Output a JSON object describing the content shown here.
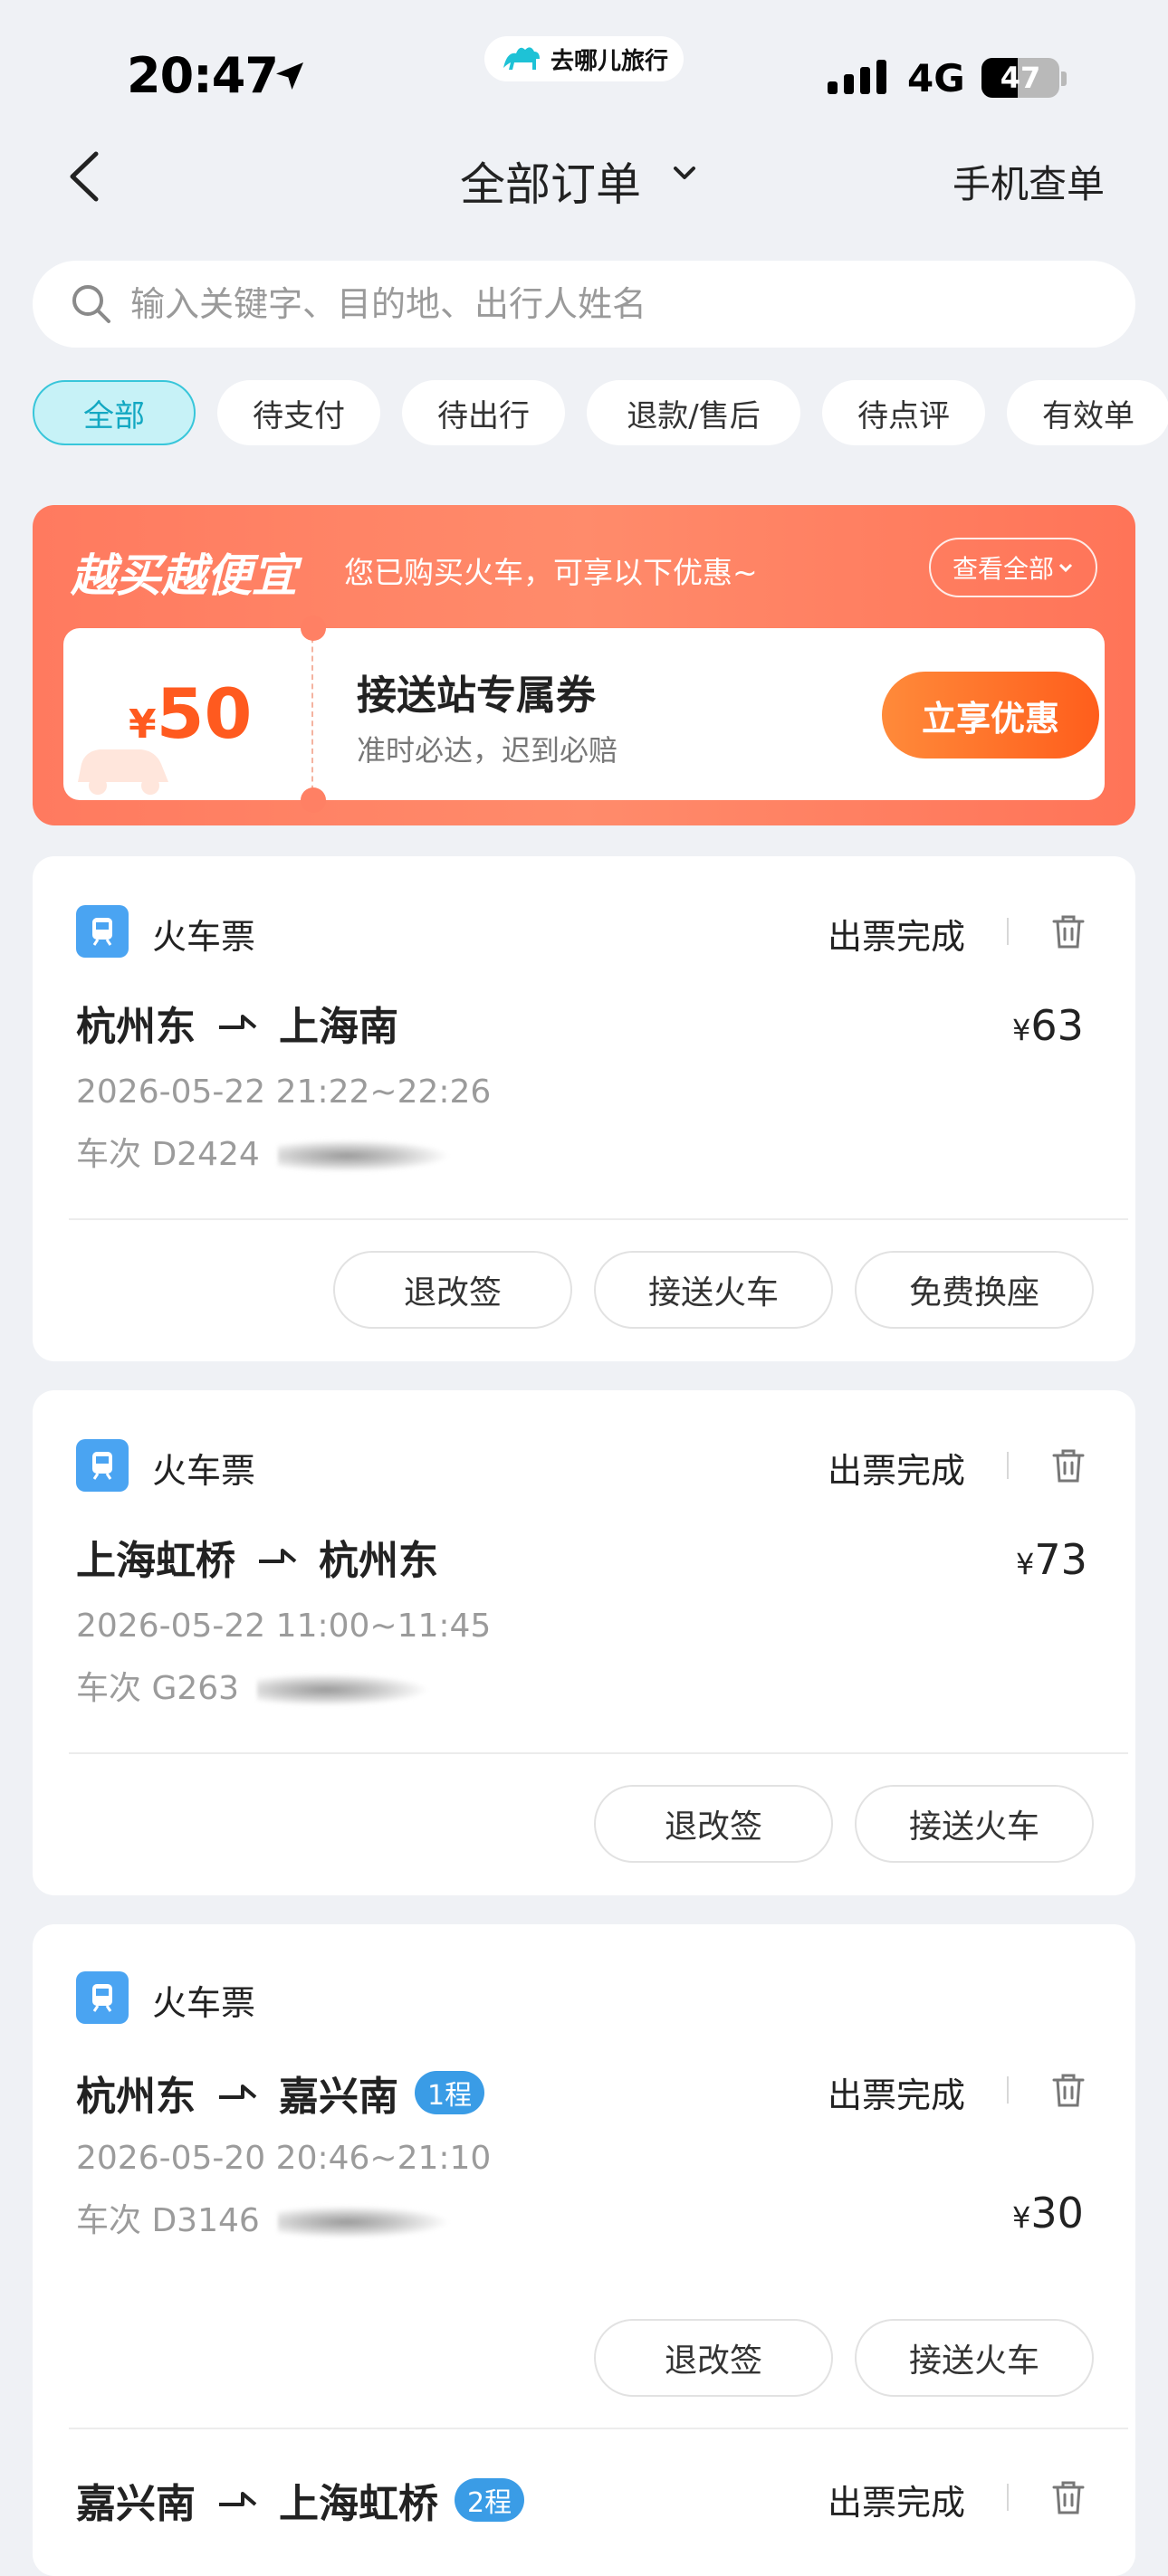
{
  "status_bar": {
    "time": "20:47",
    "island_brand": "去哪儿旅行",
    "network": "4G",
    "battery": "47",
    "battery_level": 0.47
  },
  "header": {
    "title": "全部订单",
    "phone_query": "手机查单"
  },
  "search": {
    "placeholder": "输入关键字、目的地、出行人姓名",
    "value": ""
  },
  "tabs": [
    {
      "label": "全部",
      "active": true
    },
    {
      "label": "待支付",
      "active": false
    },
    {
      "label": "待出行",
      "active": false
    },
    {
      "label": "退款/售后",
      "active": false
    },
    {
      "label": "待点评",
      "active": false
    },
    {
      "label": "有效单",
      "active": false
    }
  ],
  "promo": {
    "title": "越买越便宜",
    "subtitle": "您已购买火车，可享以下优惠~",
    "view_all": "查看全部",
    "coupon_currency": "¥",
    "coupon_amount": "50",
    "coupon_name": "接送站专属券",
    "coupon_desc": "准时必达，迟到必赔",
    "claim_button": "立享优惠"
  },
  "orders": [
    {
      "type": "火车票",
      "status": "出票完成",
      "from": "杭州东",
      "to": "上海南",
      "currency": "¥",
      "price": "63",
      "datetime": "2026-05-22 21:22~22:26",
      "train": "车次 D2424",
      "actions": [
        "退改签",
        "接送火车",
        "免费换座"
      ]
    },
    {
      "type": "火车票",
      "status": "出票完成",
      "from": "上海虹桥",
      "to": "杭州东",
      "currency": "¥",
      "price": "73",
      "datetime": "2026-05-22 11:00~11:45",
      "train": "车次 G263",
      "actions": [
        "退改签",
        "接送火车"
      ]
    },
    {
      "type": "火车票",
      "legs": [
        {
          "status": "出票完成",
          "from": "杭州东",
          "to": "嘉兴南",
          "leg": "1程",
          "currency": "¥",
          "price": "30",
          "datetime": "2026-05-20 20:46~21:10",
          "train": "车次 D3146",
          "actions": [
            "退改签",
            "接送火车"
          ]
        },
        {
          "status": "出票完成",
          "from": "嘉兴南",
          "to": "上海虹桥",
          "leg": "2程"
        }
      ]
    }
  ],
  "colors": {
    "accent": "#13a8c2",
    "promo": "#ff7a5f",
    "coupon_price": "#ff5a1f",
    "train_icon": "#4aa4f2",
    "leg_badge": "#3a9ce6"
  }
}
